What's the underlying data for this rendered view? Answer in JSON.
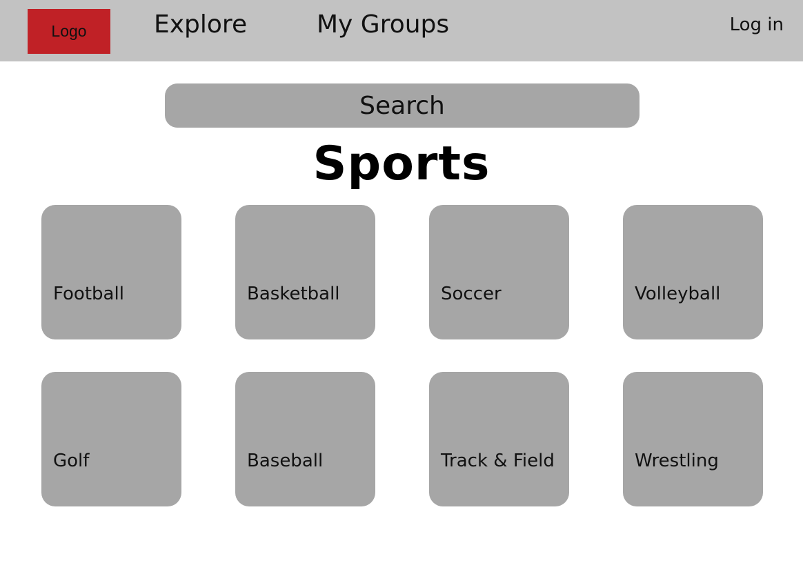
{
  "header": {
    "logo_label": "Logo",
    "nav": [
      {
        "label": "Explore"
      },
      {
        "label": "My Groups"
      }
    ],
    "login_label": "Log in"
  },
  "search": {
    "label": "Search"
  },
  "section": {
    "title": "Sports"
  },
  "categories": [
    {
      "label": "Football"
    },
    {
      "label": "Basketball"
    },
    {
      "label": "Soccer"
    },
    {
      "label": "Volleyball"
    },
    {
      "label": "Golf"
    },
    {
      "label": "Baseball"
    },
    {
      "label": "Track & Field"
    },
    {
      "label": "Wrestling"
    }
  ],
  "colors": {
    "header_background": "#c2c2c2",
    "logo_background": "#c02126",
    "tile_background": "#a6a6a6",
    "page_background": "#ffffff"
  }
}
